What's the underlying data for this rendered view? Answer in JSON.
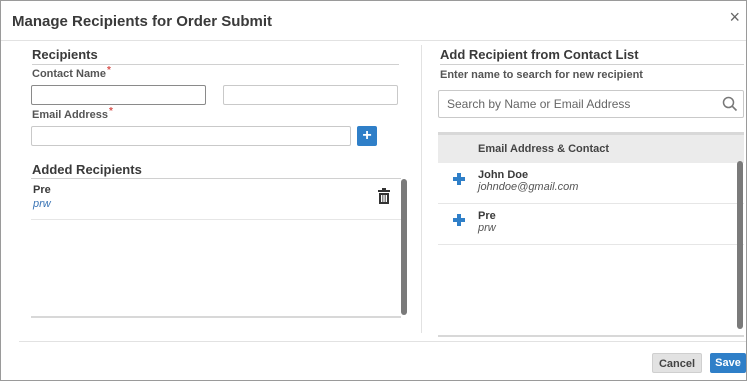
{
  "dialog": {
    "title": "Manage Recipients for Order Submit",
    "close_glyph": "×"
  },
  "left": {
    "section_title": "Recipients",
    "contact_name_label": "Contact Name",
    "email_label": "Email Address",
    "required_mark": "*",
    "first_name_value": "",
    "last_name_value": "",
    "email_value": "",
    "add_glyph": "+",
    "added_title": "Added Recipients",
    "added": [
      {
        "name": "Pre",
        "email": "prw"
      }
    ]
  },
  "right": {
    "section_title": "Add Recipient from Contact List",
    "hint": "Enter name to search for new recipient",
    "search_placeholder": "Search by Name or Email Address",
    "column_header": "Email Address & Contact",
    "contacts": [
      {
        "name": "John Doe",
        "email": "johndoe@gmail.com"
      },
      {
        "name": "Pre",
        "email": "prw"
      }
    ]
  },
  "footer": {
    "cancel_label": "Cancel",
    "save_label": "Save"
  },
  "colors": {
    "accent": "#2f7fc8",
    "link": "#3a74b5",
    "required": "#d9534f"
  }
}
